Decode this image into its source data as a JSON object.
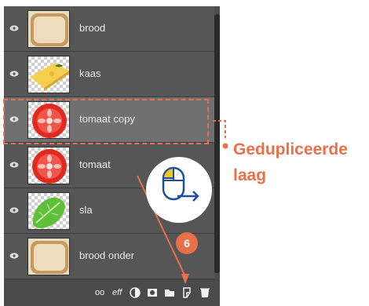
{
  "layers": [
    {
      "name": "brood",
      "thumb": "bread-slice",
      "selected": false
    },
    {
      "name": "kaas",
      "thumb": "cheese-slice",
      "selected": false
    },
    {
      "name": "tomaat copy",
      "thumb": "tomato-slice",
      "selected": true
    },
    {
      "name": "tomaat",
      "thumb": "tomato-slice",
      "selected": false
    },
    {
      "name": "sla",
      "thumb": "lettuce-leaf",
      "selected": false
    },
    {
      "name": "brood onder",
      "thumb": "bread-slice",
      "selected": false
    }
  ],
  "bottom_bar": {
    "icons": [
      "link-icon",
      "effects-icon",
      "adjustment-icon",
      "mask-icon",
      "folder-icon",
      "new-layer-icon",
      "trash-icon"
    ],
    "link_glyph": "oo",
    "effects_label": "eff"
  },
  "annotation": {
    "callout_line1": "Gedupliceerde",
    "callout_line2": "laag",
    "step_number": "6"
  },
  "colors": {
    "accent": "#e8714a",
    "panel": "#565656",
    "selected": "#707070",
    "mouse_icon": "#1e4f9c",
    "mouse_highlight": "#f5c518"
  }
}
